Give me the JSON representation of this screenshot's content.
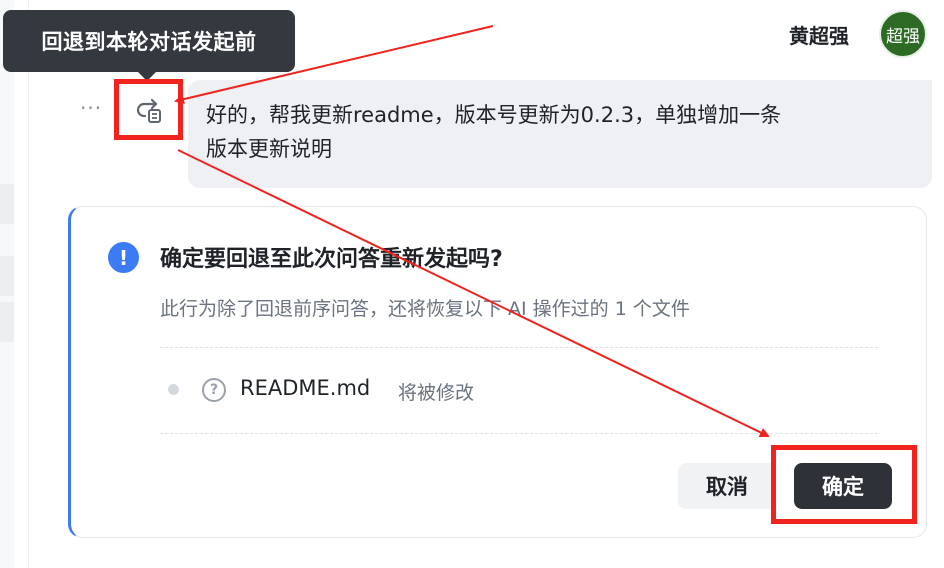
{
  "tooltip": {
    "text": "回退到本轮对话发起前"
  },
  "user": {
    "name": "黄超强",
    "avatar_text": "超强",
    "avatar_color": "#2d6b24"
  },
  "message": {
    "more_label": "···",
    "rollback_icon": "rollback-icon",
    "text_line1": "好的，帮我更新readme，版本号更新为0.2.3，单独增加一条",
    "text_line2": "版本更新说明"
  },
  "confirm": {
    "title": "确定要回退至此次问答重新发起吗?",
    "description": "此行为除了回退前序问答，还将恢复以下 AI 操作过的 1 个文件",
    "files": [
      {
        "name": "README.md",
        "status": "将被修改",
        "icon": "question-icon"
      }
    ],
    "cancel_label": "取消",
    "confirm_label": "确定",
    "accent_color": "#3c7bf6"
  },
  "annotation_color": "#f0231e"
}
